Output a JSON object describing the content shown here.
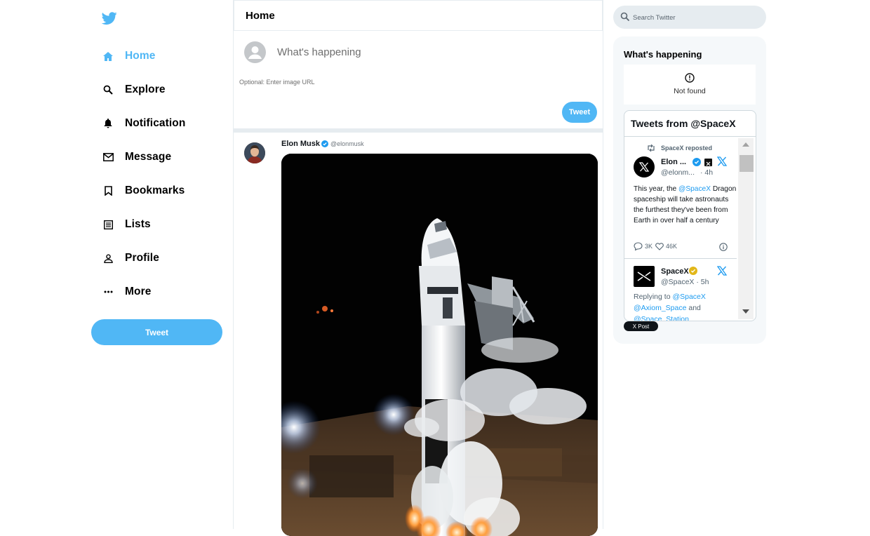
{
  "sidebar": {
    "logo_icon": "twitter-bird-icon",
    "nav": [
      {
        "label": "Home",
        "icon": "home-icon",
        "active": true
      },
      {
        "label": "Explore",
        "icon": "search-icon"
      },
      {
        "label": "Notification",
        "icon": "bell-icon"
      },
      {
        "label": "Message",
        "icon": "mail-icon"
      },
      {
        "label": "Bookmarks",
        "icon": "bookmark-icon"
      },
      {
        "label": "Lists",
        "icon": "list-icon"
      },
      {
        "label": "Profile",
        "icon": "person-icon"
      },
      {
        "label": "More",
        "icon": "more-icon"
      }
    ],
    "tweet_button": "Tweet"
  },
  "feed": {
    "title": "Home",
    "composer": {
      "placeholder": "What's happening",
      "image_placeholder": "Optional: Enter image URL",
      "tweet_button": "Tweet"
    },
    "post": {
      "display_name": "Elon Musk",
      "handle": "@elonmusk",
      "verified": true
    }
  },
  "right": {
    "search_placeholder": "Search Twitter",
    "widgets_title": "What's happening",
    "not_found_text": "Not found",
    "embed": {
      "title": "Tweets from @SpaceX",
      "repost_label": "SpaceX reposted",
      "tweet1": {
        "name": "Elon ...",
        "handle": "@elonm...",
        "time": "· 4h",
        "text_prefix": "This year, the ",
        "mention": "@SpaceX",
        "text_suffix": " Dragon spaceship will take astronauts the furthest they've been from Earth in over half a century",
        "replies": "3K",
        "likes": "46K"
      },
      "tweet2": {
        "name": "SpaceX",
        "handle": "@SpaceX · 5h",
        "replying_prefix": "Replying to ",
        "mention1": "@SpaceX",
        "mention2": "@Axiom_Space",
        "and_word": " and",
        "mention3": "@Space_Station"
      },
      "x_post_button": "X Post"
    }
  },
  "colors": {
    "accent": "#50b7f5",
    "link": "#1d9bf0",
    "border": "#e6ecf0",
    "panel": "#f5f8fa"
  }
}
